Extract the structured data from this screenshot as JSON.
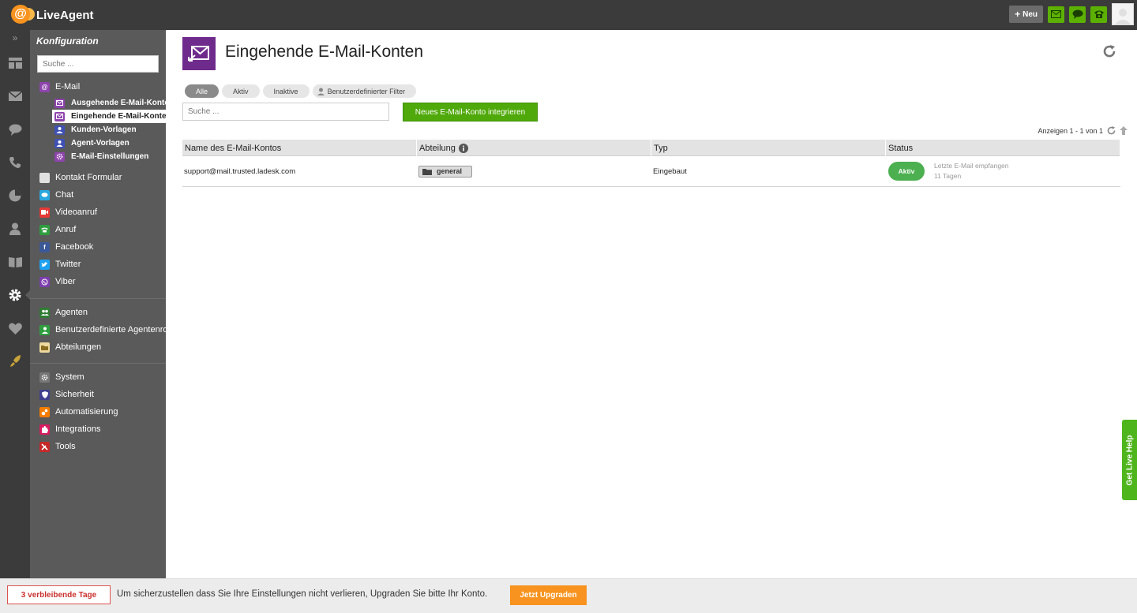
{
  "app": {
    "logo_text": "LiveAgent"
  },
  "topbar": {
    "new_label": "Neu",
    "new_icon": "plus-icon",
    "icons": [
      "email-icon",
      "chat-icon",
      "phone-icon"
    ]
  },
  "rail": {
    "icons": [
      "dashboard-icon",
      "tickets-icon",
      "chat-icon",
      "calls-icon",
      "reports-icon",
      "contacts-icon",
      "knowledgebase-icon",
      "configuration-icon",
      "heart-icon",
      "rocket-icon"
    ]
  },
  "sidebar": {
    "title": "Konfiguration",
    "search_placeholder": "Suche ...",
    "email_label": "E-Mail",
    "email_sub": [
      "Ausgehende E-Mail-Konten",
      "Eingehende E-Mail-Konten",
      "Kunden-Vorlagen",
      "Agent-Vorlagen",
      "E-Mail-Einstellungen"
    ],
    "channels": [
      "Kontakt Formular",
      "Chat",
      "Videoanruf",
      "Anruf",
      "Facebook",
      "Twitter",
      "Viber"
    ],
    "people": [
      "Agenten",
      "Benutzerdefinierte Agentenrolle",
      "Abteilungen"
    ],
    "system": [
      "System",
      "Sicherheit",
      "Automatisierung",
      "Integrations",
      "Tools"
    ]
  },
  "main": {
    "title": "Eingehende E-Mail-Konten",
    "filters": [
      "Alle",
      "Aktiv",
      "Inaktive",
      "Benutzerdefinierter Filter"
    ],
    "search_placeholder": "Suche ...",
    "new_button": "Neues E-Mail-Konto integrieren",
    "paging": "Anzeigen 1 - 1 von 1",
    "columns": [
      "Name des E-Mail-Kontos",
      "Abteilung",
      "Typ",
      "Status"
    ],
    "rows": [
      {
        "name": "support@mail.trusted.ladesk.com",
        "department": "general",
        "type": "Eingebaut",
        "status": "Aktiv",
        "last_line1": "Letzte E-Mail empfangen",
        "last_line2": "11 Tagen"
      }
    ]
  },
  "live_help": "Get Live Help",
  "bottom": {
    "days_left": "3 verbleibende Tage",
    "message": "Um sicherzustellen dass Sie Ihre Einstellungen nicht verlieren, Upgraden Sie bitte Ihr Konto.",
    "upgrade_button": "Jetzt Upgraden"
  },
  "colors": {
    "accent_green": "#4fa90a",
    "email_purple": "#6e2b8c",
    "upgrade_orange": "#f7931e",
    "status_green": "#4caf50"
  }
}
